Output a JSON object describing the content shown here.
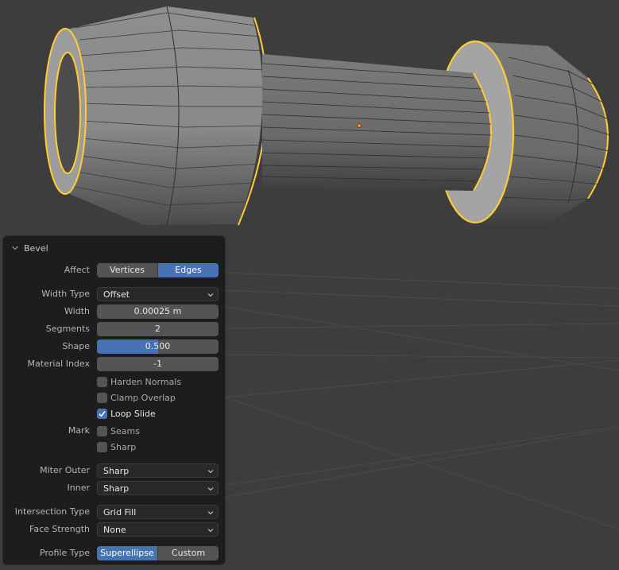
{
  "viewport": {
    "description": "3D viewport showing a grey cylindrical mesh with yellow selected edge loops, floor grid",
    "colors": {
      "background": "#3d3d3d",
      "grid": "#4a4a4a",
      "mesh_light": "#9a9a9a",
      "mesh_mid": "#7a7a7a",
      "mesh_dark": "#505050",
      "selected_edge": "#ffcc33",
      "origin_dot": "#ff8c1a"
    }
  },
  "operator_panel": {
    "title": "Bevel",
    "expanded": true,
    "affect": {
      "label": "Affect",
      "options": [
        "Vertices",
        "Edges"
      ],
      "selected": "Edges"
    },
    "width_type": {
      "label": "Width Type",
      "value": "Offset"
    },
    "width": {
      "label": "Width",
      "value": "0.00025 m"
    },
    "segments": {
      "label": "Segments",
      "value": "2"
    },
    "shape": {
      "label": "Shape",
      "value": "0.500",
      "fraction": 0.5
    },
    "material_index": {
      "label": "Material Index",
      "value": "-1"
    },
    "checkboxes": [
      {
        "label": "Harden Normals",
        "checked": false
      },
      {
        "label": "Clamp Overlap",
        "checked": false
      },
      {
        "label": "Loop Slide",
        "checked": true
      }
    ],
    "mark": {
      "label": "Mark",
      "options": [
        {
          "label": "Seams",
          "checked": false
        },
        {
          "label": "Sharp",
          "checked": false
        }
      ]
    },
    "miter_outer": {
      "label": "Miter Outer",
      "value": "Sharp"
    },
    "miter_inner": {
      "label": "Inner",
      "value": "Sharp"
    },
    "intersection_type": {
      "label": "Intersection Type",
      "value": "Grid Fill"
    },
    "face_strength": {
      "label": "Face Strength",
      "value": "None"
    },
    "profile_type": {
      "label": "Profile Type",
      "options": [
        "Superellipse",
        "Custom"
      ],
      "selected": "Superellipse"
    },
    "accent_color": "#4772b3"
  }
}
